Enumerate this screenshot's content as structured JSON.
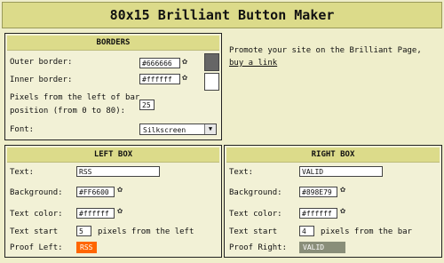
{
  "title": "80x15 Brilliant Button Maker",
  "borders": {
    "header": "BORDERS",
    "outer_label": "Outer border:",
    "outer_value": "#666666",
    "outer_swatch": "#666666",
    "inner_label": "Inner border:",
    "inner_value": "#ffffff",
    "inner_swatch": "#ffffff",
    "pixels_label_1": "Pixels from the left of bar",
    "pixels_label_2": "position (from 0 to 80):",
    "pixels_value": "25",
    "font_label": "Font:",
    "font_value": "Silkscreen"
  },
  "promo": {
    "text": "Promote your site on the Brilliant Page,",
    "link": "buy a link"
  },
  "left_box": {
    "header": "LEFT BOX",
    "text_label": "Text:",
    "text_value": "RSS",
    "bg_label": "Background:",
    "bg_value": "#FF6600",
    "color_label": "Text color:",
    "color_value": "#ffffff",
    "start_label": "Text start",
    "start_value": "5",
    "start_suffix": "pixels from the left",
    "proof_label": "Proof Left:",
    "proof_text": "RSS",
    "proof_bg": "#ff6600",
    "proof_fg": "#ffffff"
  },
  "right_box": {
    "header": "RIGHT BOX",
    "text_label": "Text:",
    "text_value": "VALID",
    "bg_label": "Background:",
    "bg_value": "#898E79",
    "color_label": "Text color:",
    "color_value": "#ffffff",
    "start_label": "Text start",
    "start_value": "4",
    "start_suffix": "pixels from the bar",
    "proof_label": "Proof Right:",
    "proof_text": "VALID",
    "proof_bg": "#898e79",
    "proof_fg": "#ffffff"
  },
  "icons": {
    "picker": "color-picker-icon",
    "dropdown": "chevron-down-icon"
  }
}
